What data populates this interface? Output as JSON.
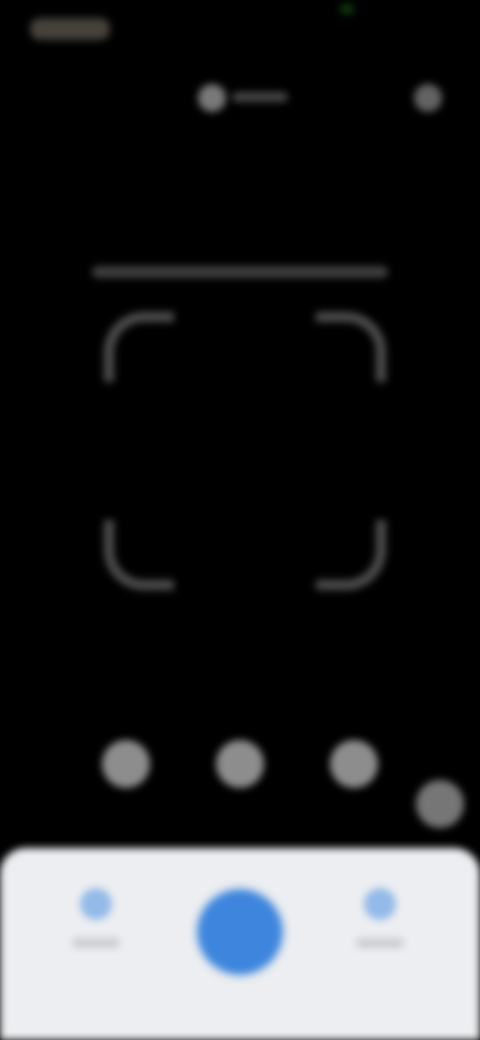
{
  "app": {
    "screen": "scanner"
  },
  "status_bar": {
    "time": "",
    "indicator_color": "#1e781e"
  },
  "top_bar": {
    "flash_icon": "flash-icon",
    "flash_label": "",
    "more_icon": "more-icon"
  },
  "scan_frame": {
    "corner_color": "#aaaaaa"
  },
  "modes": [
    {
      "name": "mode-1"
    },
    {
      "name": "mode-2"
    },
    {
      "name": "mode-3"
    },
    {
      "name": "mode-4"
    }
  ],
  "bottom_panel": {
    "left_button": {
      "icon": "album-icon",
      "label": ""
    },
    "shutter": {
      "icon": "shutter-icon"
    },
    "right_button": {
      "icon": "history-icon",
      "label": ""
    },
    "accent_color": "#3e86dd"
  }
}
